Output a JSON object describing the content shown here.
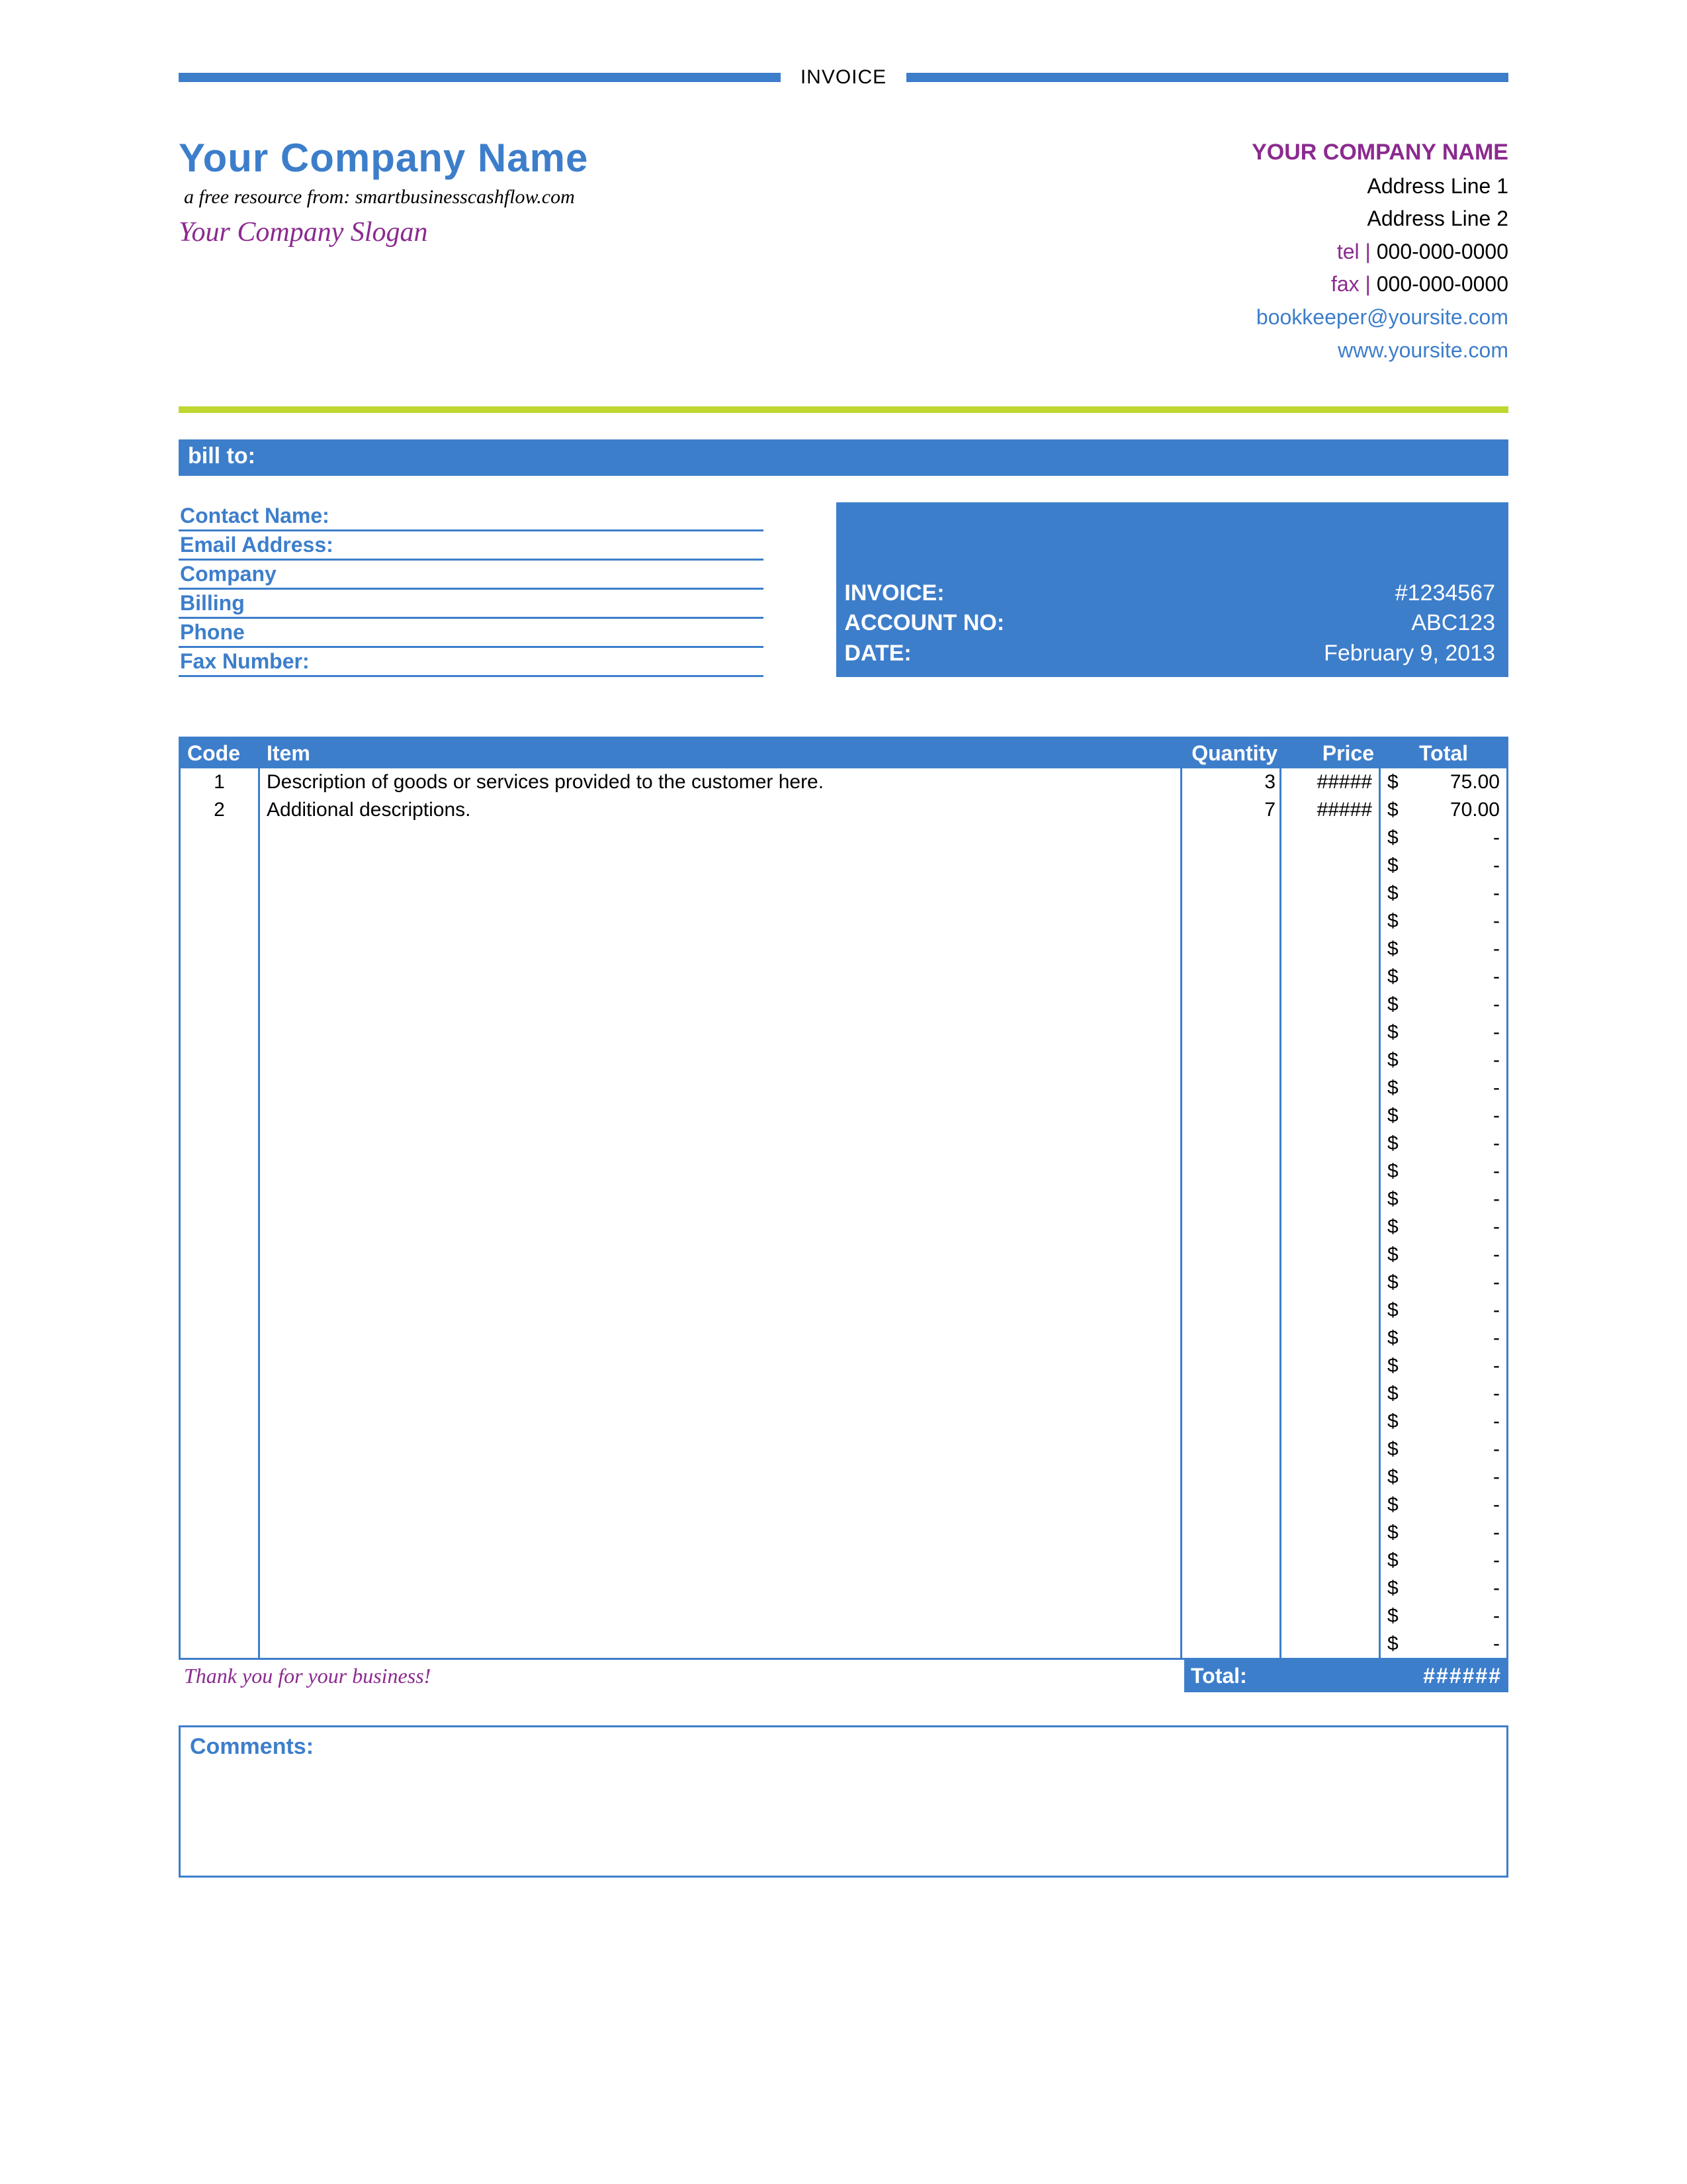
{
  "title": "INVOICE",
  "company": {
    "name_left": "Your Company Name",
    "resource_line": "a free resource from: smartbusinesscashflow.com",
    "slogan": "Your Company Slogan",
    "name_right": "YOUR COMPANY NAME",
    "address1": "Address Line 1",
    "address2": "Address Line 2",
    "tel_label": "tel |",
    "tel": " 000-000-0000",
    "fax_label": "fax |",
    "fax": " 000-000-0000",
    "email": "bookkeeper@yoursite.com",
    "website": "www.yoursite.com"
  },
  "bill_to_label": "bill to:",
  "bill_fields": {
    "contact": "Contact Name:",
    "email": "Email Address:",
    "company": "Company",
    "billing": "Billing",
    "phone": "Phone",
    "fax": "Fax Number:"
  },
  "invoice_meta": {
    "invoice_label": "INVOICE:",
    "invoice_no": "#1234567",
    "account_label": "ACCOUNT NO:",
    "account_no": "ABC123",
    "date_label": "DATE:",
    "date": "February 9, 2013"
  },
  "columns": {
    "code": "Code",
    "item": "Item",
    "qty": "Quantity",
    "price": "Price",
    "total": "Total"
  },
  "rows": [
    {
      "code": "1",
      "item": "Description of goods or services provided to the customer here.",
      "qty": "3",
      "price": "#####",
      "currency": "$",
      "total": "75.00"
    },
    {
      "code": "2",
      "item": "Additional descriptions.",
      "qty": "7",
      "price": "#####",
      "currency": "$",
      "total": "70.00"
    },
    {
      "code": "",
      "item": "",
      "qty": "",
      "price": "",
      "currency": "$",
      "total": "-"
    },
    {
      "code": "",
      "item": "",
      "qty": "",
      "price": "",
      "currency": "$",
      "total": "-"
    },
    {
      "code": "",
      "item": "",
      "qty": "",
      "price": "",
      "currency": "$",
      "total": "-"
    },
    {
      "code": "",
      "item": "",
      "qty": "",
      "price": "",
      "currency": "$",
      "total": "-"
    },
    {
      "code": "",
      "item": "",
      "qty": "",
      "price": "",
      "currency": "$",
      "total": "-"
    },
    {
      "code": "",
      "item": "",
      "qty": "",
      "price": "",
      "currency": "$",
      "total": "-"
    },
    {
      "code": "",
      "item": "",
      "qty": "",
      "price": "",
      "currency": "$",
      "total": "-"
    },
    {
      "code": "",
      "item": "",
      "qty": "",
      "price": "",
      "currency": "$",
      "total": "-"
    },
    {
      "code": "",
      "item": "",
      "qty": "",
      "price": "",
      "currency": "$",
      "total": "-"
    },
    {
      "code": "",
      "item": "",
      "qty": "",
      "price": "",
      "currency": "$",
      "total": "-"
    },
    {
      "code": "",
      "item": "",
      "qty": "",
      "price": "",
      "currency": "$",
      "total": "-"
    },
    {
      "code": "",
      "item": "",
      "qty": "",
      "price": "",
      "currency": "$",
      "total": "-"
    },
    {
      "code": "",
      "item": "",
      "qty": "",
      "price": "",
      "currency": "$",
      "total": "-"
    },
    {
      "code": "",
      "item": "",
      "qty": "",
      "price": "",
      "currency": "$",
      "total": "-"
    },
    {
      "code": "",
      "item": "",
      "qty": "",
      "price": "",
      "currency": "$",
      "total": "-"
    },
    {
      "code": "",
      "item": "",
      "qty": "",
      "price": "",
      "currency": "$",
      "total": "-"
    },
    {
      "code": "",
      "item": "",
      "qty": "",
      "price": "",
      "currency": "$",
      "total": "-"
    },
    {
      "code": "",
      "item": "",
      "qty": "",
      "price": "",
      "currency": "$",
      "total": "-"
    },
    {
      "code": "",
      "item": "",
      "qty": "",
      "price": "",
      "currency": "$",
      "total": "-"
    },
    {
      "code": "",
      "item": "",
      "qty": "",
      "price": "",
      "currency": "$",
      "total": "-"
    },
    {
      "code": "",
      "item": "",
      "qty": "",
      "price": "",
      "currency": "$",
      "total": "-"
    },
    {
      "code": "",
      "item": "",
      "qty": "",
      "price": "",
      "currency": "$",
      "total": "-"
    },
    {
      "code": "",
      "item": "",
      "qty": "",
      "price": "",
      "currency": "$",
      "total": "-"
    },
    {
      "code": "",
      "item": "",
      "qty": "",
      "price": "",
      "currency": "$",
      "total": "-"
    },
    {
      "code": "",
      "item": "",
      "qty": "",
      "price": "",
      "currency": "$",
      "total": "-"
    },
    {
      "code": "",
      "item": "",
      "qty": "",
      "price": "",
      "currency": "$",
      "total": "-"
    },
    {
      "code": "",
      "item": "",
      "qty": "",
      "price": "",
      "currency": "$",
      "total": "-"
    },
    {
      "code": "",
      "item": "",
      "qty": "",
      "price": "",
      "currency": "$",
      "total": "-"
    },
    {
      "code": "",
      "item": "",
      "qty": "",
      "price": "",
      "currency": "$",
      "total": "-"
    },
    {
      "code": "",
      "item": "",
      "qty": "",
      "price": "",
      "currency": "$",
      "total": "-"
    }
  ],
  "footer": {
    "thank_you": "Thank you for your business!",
    "total_label": "Total:",
    "total_value": "######"
  },
  "comments_label": "Comments:"
}
